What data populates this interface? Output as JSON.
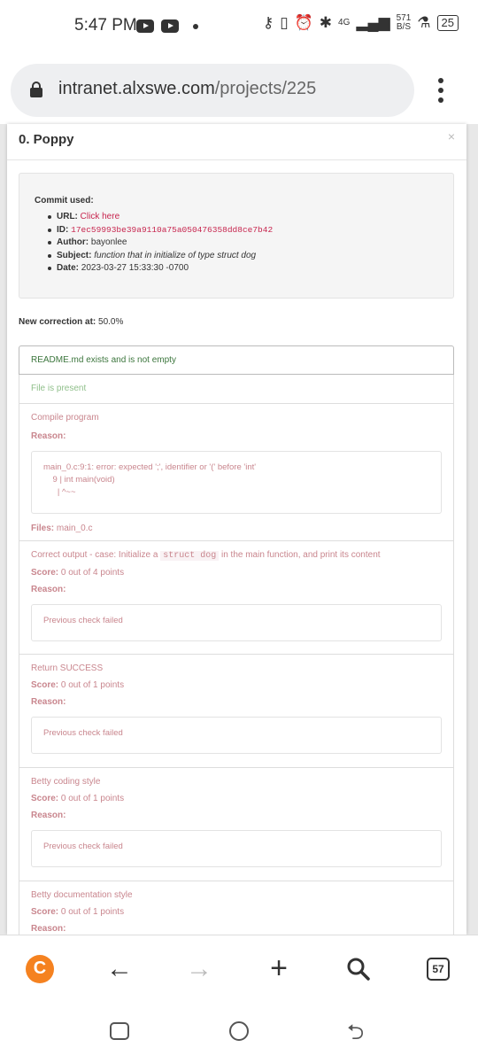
{
  "status_bar": {
    "time": "5:47 PM",
    "network": "4G",
    "speed_value": "571",
    "speed_unit": "B/S",
    "battery": "25"
  },
  "browser": {
    "url_domain": "intranet.alxswe.com",
    "url_path": "/projects/225",
    "tabs_count": "57"
  },
  "modal": {
    "title": "0. Poppy",
    "close": "×",
    "commit": {
      "heading": "Commit used:",
      "url_label": "URL:",
      "url_value": "Click here",
      "id_label": "ID:",
      "id_value": "17ec59993be39a9110a75a050476358dd8ce7b42",
      "author_label": "Author:",
      "author_value": "bayonlee",
      "subject_label": "Subject:",
      "subject_value": "function that in initialize of type struct dog",
      "date_label": "Date:",
      "date_value": "2023-03-27 15:33:30 -0700"
    },
    "correction_label": "New correction at:",
    "correction_value": "50.0%",
    "checks": [
      {
        "title": "README.md exists and is not empty"
      },
      {
        "title": "File is present"
      },
      {
        "title": "Compile program",
        "reason_label": "Reason:",
        "reason": "main_0.c:9:1: error: expected ';', identifier or '(' before 'int'\n    9 | int main(void)\n      | ^~~",
        "files_label": "Files:",
        "files_value": "main_0.c"
      },
      {
        "title_pre": "Correct output - case: Initialize a",
        "title_code": "struct dog",
        "title_post": "in the main function, and print its content",
        "score_label": "Score:",
        "score_value": "0 out of 4 points",
        "reason_label": "Reason:",
        "reason": "Previous check failed"
      },
      {
        "title": "Return SUCCESS",
        "score_label": "Score:",
        "score_value": "0 out of 1 points",
        "reason_label": "Reason:",
        "reason": "Previous check failed"
      },
      {
        "title": "Betty coding style",
        "score_label": "Score:",
        "score_value": "0 out of 1 points",
        "reason_label": "Reason:",
        "reason": "Previous check failed"
      },
      {
        "title": "Betty documentation style",
        "score_label": "Score:",
        "score_value": "0 out of 1 points",
        "reason_label": "Reason:"
      }
    ]
  },
  "icons": [
    "lock-icon",
    "youtube-icon",
    "key-icon",
    "vibrate-icon",
    "alarm-icon",
    "bluetooth-icon",
    "signal-icon",
    "flask-icon",
    "battery-icon",
    "menu-dots-icon",
    "app-logo-icon",
    "back-arrow-icon",
    "forward-arrow-icon",
    "plus-icon",
    "search-icon",
    "tabs-icon"
  ],
  "colors": {
    "fail": "#c9868e",
    "pass": "#3c763d",
    "link": "#c7254e",
    "brand": "#f58220"
  }
}
